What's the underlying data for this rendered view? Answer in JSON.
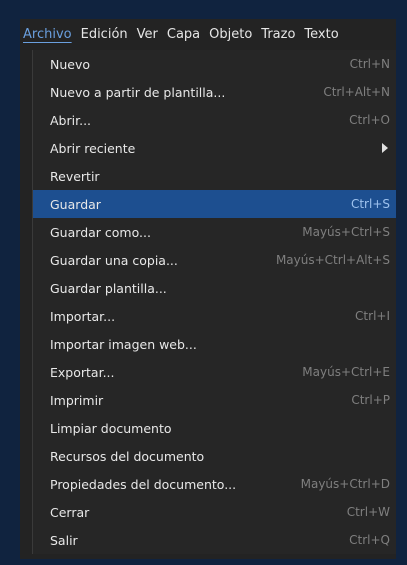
{
  "menubar": {
    "items": [
      {
        "label": "Archivo",
        "active": true
      },
      {
        "label": "Edición"
      },
      {
        "label": "Ver"
      },
      {
        "label": "Capa"
      },
      {
        "label": "Objeto"
      },
      {
        "label": "Trazo"
      },
      {
        "label": "Texto"
      }
    ]
  },
  "menu": {
    "selected_index": 5,
    "items": [
      {
        "label": "Nuevo",
        "shortcut": "Ctrl+N"
      },
      {
        "label": "Nuevo a partir de plantilla...",
        "shortcut": "Ctrl+Alt+N"
      },
      {
        "label": "Abrir...",
        "shortcut": "Ctrl+O"
      },
      {
        "label": "Abrir reciente",
        "shortcut": "",
        "submenu_icon": "chevron-right-icon"
      },
      {
        "label": "Revertir",
        "shortcut": ""
      },
      {
        "label": "Guardar",
        "shortcut": "Ctrl+S"
      },
      {
        "label": "Guardar como...",
        "shortcut": "Mayús+Ctrl+S"
      },
      {
        "label": "Guardar una copia...",
        "shortcut": "Mayús+Ctrl+Alt+S"
      },
      {
        "label": "Guardar plantilla...",
        "shortcut": ""
      },
      {
        "label": "Importar...",
        "shortcut": "Ctrl+I"
      },
      {
        "label": "Importar imagen web...",
        "shortcut": ""
      },
      {
        "label": "Exportar...",
        "shortcut": "Mayús+Ctrl+E"
      },
      {
        "label": "Imprimir",
        "shortcut": "Ctrl+P"
      },
      {
        "label": "Limpiar documento",
        "shortcut": ""
      },
      {
        "label": "Recursos del documento",
        "shortcut": ""
      },
      {
        "label": "Propiedades del documento...",
        "shortcut": "Mayús+Ctrl+D"
      },
      {
        "label": "Cerrar",
        "shortcut": "Ctrl+W"
      },
      {
        "label": "Salir",
        "shortcut": "Ctrl+Q"
      }
    ]
  },
  "colors": {
    "accent": "#1d4f90",
    "active_menu_text": "#6a9fde",
    "background": "#10233f"
  }
}
